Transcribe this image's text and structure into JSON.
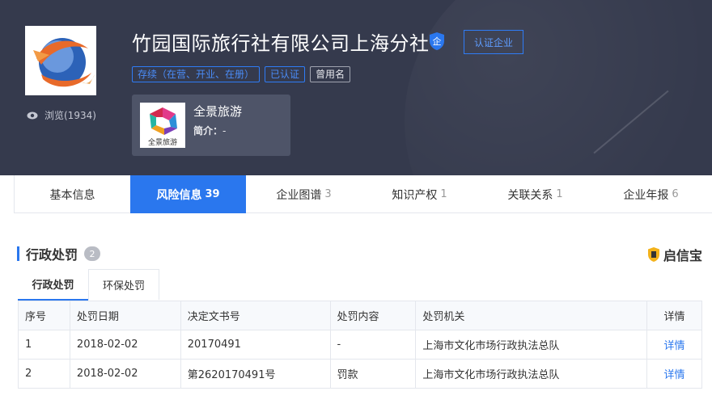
{
  "header": {
    "company_name": "竹园国际旅行社有限公司上海分社",
    "shield_char": "企",
    "certify_button": "认证企业",
    "views_label": "浏览(1934)",
    "tags": [
      {
        "label": "存续（在营、开业、在册）",
        "style": "blue"
      },
      {
        "label": "已认证",
        "style": "blue"
      },
      {
        "label": "曾用名",
        "style": "gray"
      }
    ],
    "brand": {
      "name": "全景旅游",
      "intro_label": "简介：",
      "intro_value": "-",
      "logo_text": "全景旅游"
    }
  },
  "tabs": [
    {
      "label": "基本信息",
      "count": "",
      "active": false
    },
    {
      "label": "风险信息",
      "count": "39",
      "active": true
    },
    {
      "label": "企业图谱",
      "count": "3",
      "active": false
    },
    {
      "label": "知识产权",
      "count": "1",
      "active": false
    },
    {
      "label": "关联关系",
      "count": "1",
      "active": false
    },
    {
      "label": "企业年报",
      "count": "6",
      "active": false
    }
  ],
  "section": {
    "title": "行政处罚",
    "count": "2",
    "brand_label": "启信宝"
  },
  "subtabs": [
    {
      "label": "行政处罚",
      "active": true
    },
    {
      "label": "环保处罚",
      "active": false
    }
  ],
  "table": {
    "headers": [
      "序号",
      "处罚日期",
      "决定文书号",
      "处罚内容",
      "处罚机关",
      "详情"
    ],
    "rows": [
      [
        "1",
        "2018-02-02",
        "20170491",
        "-",
        "上海市文化市场行政执法总队",
        "详情"
      ],
      [
        "2",
        "2018-02-02",
        "第2620170491号",
        "罚款",
        "上海市文化市场行政执法总队",
        "详情"
      ]
    ]
  },
  "colors": {
    "header_bg": "#353a4d",
    "accent": "#2a77ee"
  }
}
